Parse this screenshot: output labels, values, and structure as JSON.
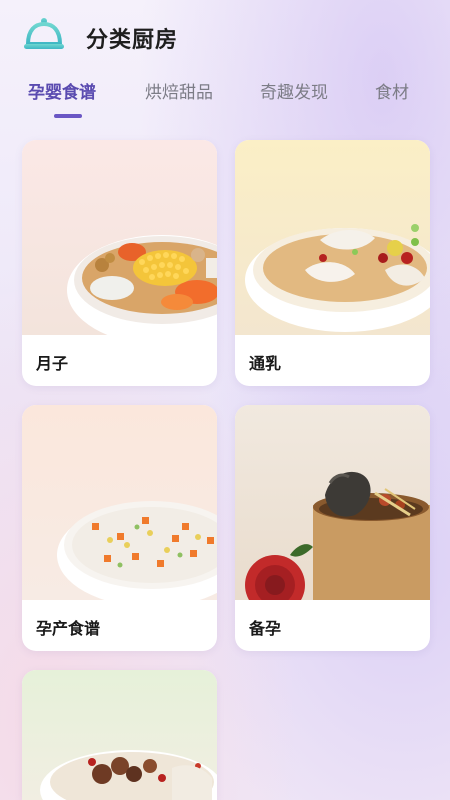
{
  "header": {
    "title": "分类厨房",
    "logo_icon": "cloche-icon"
  },
  "tabs": [
    {
      "label": "孕婴食谱",
      "active": true
    },
    {
      "label": "烘焙甜品",
      "active": false
    },
    {
      "label": "奇趣发现",
      "active": false
    },
    {
      "label": "食材",
      "active": false
    }
  ],
  "colors": {
    "accent": "#5a4bb0",
    "tab_inactive": "#7c7c86"
  },
  "cards": [
    {
      "label": "月子",
      "image": "corn-carrot-soup-photo"
    },
    {
      "label": "通乳",
      "image": "fish-soup-photo"
    },
    {
      "label": "孕产食谱",
      "image": "vegetable-rice-porridge-photo"
    },
    {
      "label": "备孕",
      "image": "black-chicken-soup-photo"
    },
    {
      "label": "",
      "image": "chicken-mushroom-soup-photo"
    }
  ]
}
